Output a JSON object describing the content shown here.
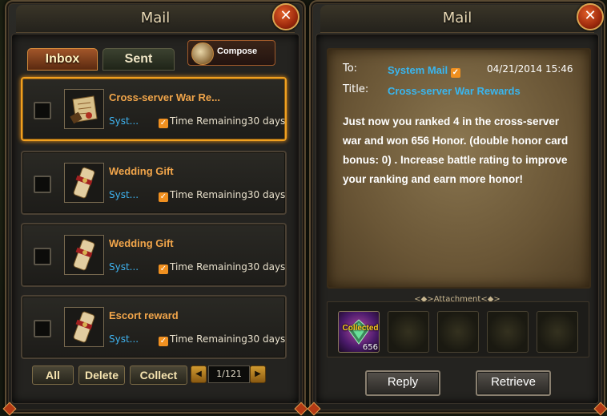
{
  "left_panel": {
    "title": "Mail",
    "tabs": [
      {
        "label": "Inbox",
        "active": true
      },
      {
        "label": "Sent",
        "active": false
      }
    ],
    "compose_label": "Compose",
    "items": [
      {
        "title": "Cross-server War Re...",
        "sender": "Syst...",
        "time": "Time Remaining30 days",
        "icon": "treasure-map-icon",
        "selected": true
      },
      {
        "title": "Wedding Gift",
        "sender": "Syst...",
        "time": "Time Remaining30 days",
        "icon": "scroll-icon",
        "selected": false
      },
      {
        "title": "Wedding Gift",
        "sender": "Syst...",
        "time": "Time Remaining30 days",
        "icon": "scroll-icon",
        "selected": false
      },
      {
        "title": "Escort reward",
        "sender": "Syst...",
        "time": "Time Remaining30 days",
        "icon": "scroll-icon",
        "selected": false
      }
    ],
    "buttons": {
      "all": "All",
      "delete": "Delete",
      "collect": "Collect"
    },
    "pagination": "1/121"
  },
  "right_panel": {
    "title": "Mail",
    "to_label": "To:",
    "sender": "System Mail",
    "date": "04/21/2014 15:46",
    "title_label": "Title:",
    "subject": "Cross-server War Rewards",
    "body": "Just now you ranked 4 in the cross-server war and won 656 Honor. (double honor card bonus: 0) . Increase battle rating to improve your ranking and earn more honor!",
    "attachment_label": "Attachment",
    "attachment": {
      "status": "Collected",
      "quantity": "656"
    },
    "reply_label": "Reply",
    "retrieve_label": "Retrieve"
  },
  "colors": {
    "accent": "#f0a020",
    "link": "#3fb3f0",
    "item_title": "#f1a54a"
  }
}
